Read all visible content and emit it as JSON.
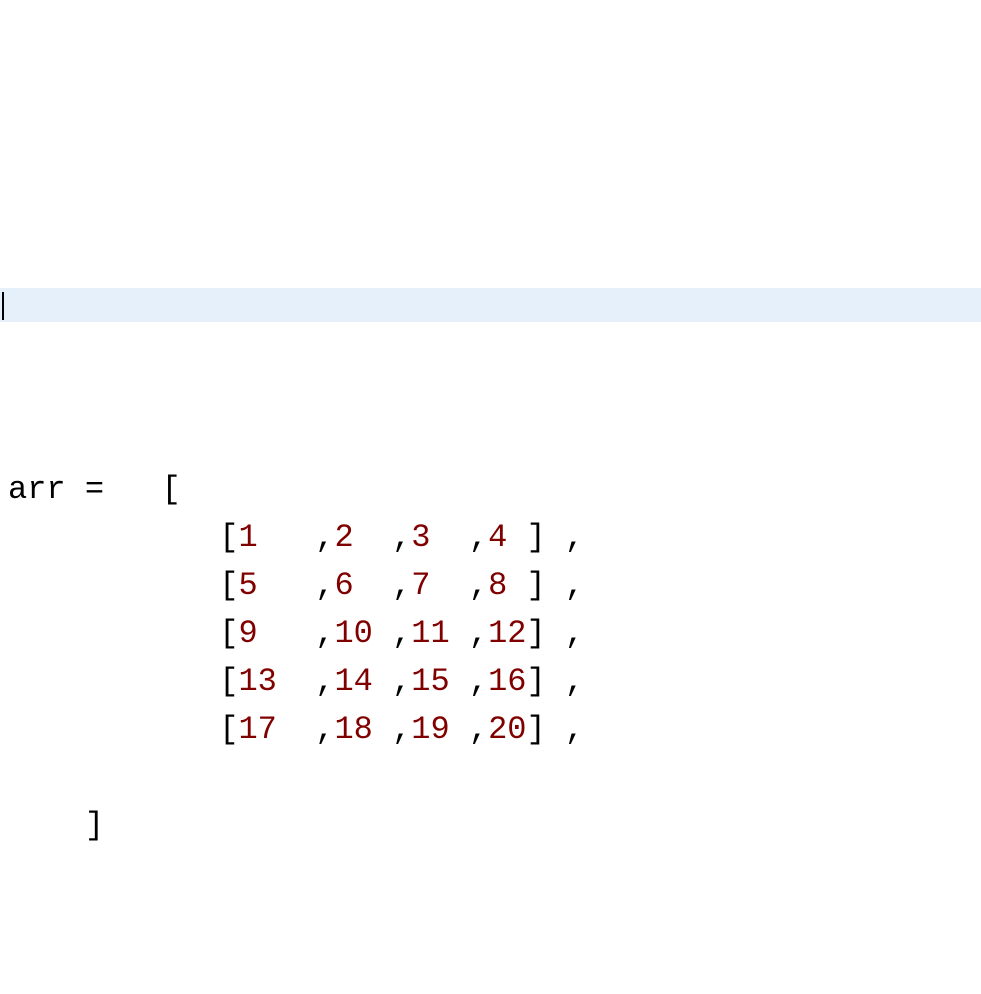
{
  "code": {
    "variable": "arr",
    "assign_op": "=",
    "outer_open": "[",
    "outer_close": "]",
    "rows": [
      {
        "open": "[",
        "vals": [
          "1",
          "2",
          "3",
          "4"
        ],
        "close": "]",
        "trail": ","
      },
      {
        "open": "[",
        "vals": [
          "5",
          "6",
          "7",
          "8"
        ],
        "close": "]",
        "trail": ","
      },
      {
        "open": "[",
        "vals": [
          "9",
          "10",
          "11",
          "12"
        ],
        "close": "]",
        "trail": ","
      },
      {
        "open": "[",
        "vals": [
          "13",
          "14",
          "15",
          "16"
        ],
        "close": "]",
        "trail": ","
      },
      {
        "open": "[",
        "vals": [
          "17",
          "18",
          "19",
          "20"
        ],
        "close": "]",
        "trail": ","
      }
    ],
    "sep": ","
  }
}
